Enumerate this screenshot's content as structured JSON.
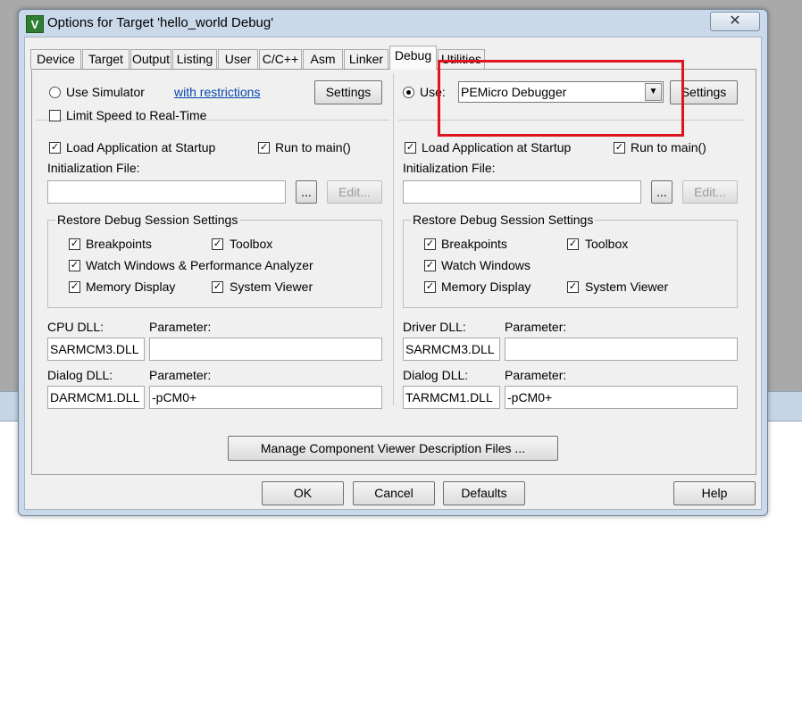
{
  "window": {
    "title": "Options for Target 'hello_world Debug'",
    "app_icon": "V",
    "close_glyph": "✕"
  },
  "tabs": [
    "Device",
    "Target",
    "Output",
    "Listing",
    "User",
    "C/C++",
    "Asm",
    "Linker",
    "Debug",
    "Utilities"
  ],
  "left": {
    "use_simulator": "Use Simulator",
    "restrictions_link": "with restrictions",
    "settings": "Settings",
    "limit_speed": "Limit Speed to Real-Time",
    "load_app": "Load Application at Startup",
    "run_to_main": "Run to main()",
    "init_file_label": "Initialization File:",
    "browse": "...",
    "edit": "Edit...",
    "restore_title": "Restore Debug Session Settings",
    "breakpoints": "Breakpoints",
    "toolbox": "Toolbox",
    "watch": "Watch Windows & Performance Analyzer",
    "memory": "Memory Display",
    "sysviewer": "System Viewer",
    "dll_label": "CPU DLL:",
    "param_label": "Parameter:",
    "dll_value": "SARMCM3.DLL",
    "param_value": "",
    "dialog_dll_label": "Dialog DLL:",
    "dialog_param_label": "Parameter:",
    "dialog_dll_value": "DARMCM1.DLL",
    "dialog_param_value": "-pCM0+"
  },
  "right": {
    "use": "Use:",
    "debugger": "PEMicro Debugger",
    "settings": "Settings",
    "load_app": "Load Application at Startup",
    "run_to_main": "Run to main()",
    "init_file_label": "Initialization File:",
    "browse": "...",
    "edit": "Edit...",
    "restore_title": "Restore Debug Session Settings",
    "breakpoints": "Breakpoints",
    "toolbox": "Toolbox",
    "watch": "Watch Windows",
    "memory": "Memory Display",
    "sysviewer": "System Viewer",
    "dll_label": "Driver DLL:",
    "param_label": "Parameter:",
    "dll_value": "SARMCM3.DLL",
    "param_value": "",
    "dialog_dll_label": "Dialog DLL:",
    "dialog_param_label": "Parameter:",
    "dialog_dll_value": "TARMCM1.DLL",
    "dialog_param_value": "-pCM0+"
  },
  "manage_button": "Manage Component Viewer Description Files ...",
  "footer": {
    "ok": "OK",
    "cancel": "Cancel",
    "defaults": "Defaults",
    "help": "Help"
  },
  "checkmark": "✓",
  "dropdown_glyph": "▼"
}
